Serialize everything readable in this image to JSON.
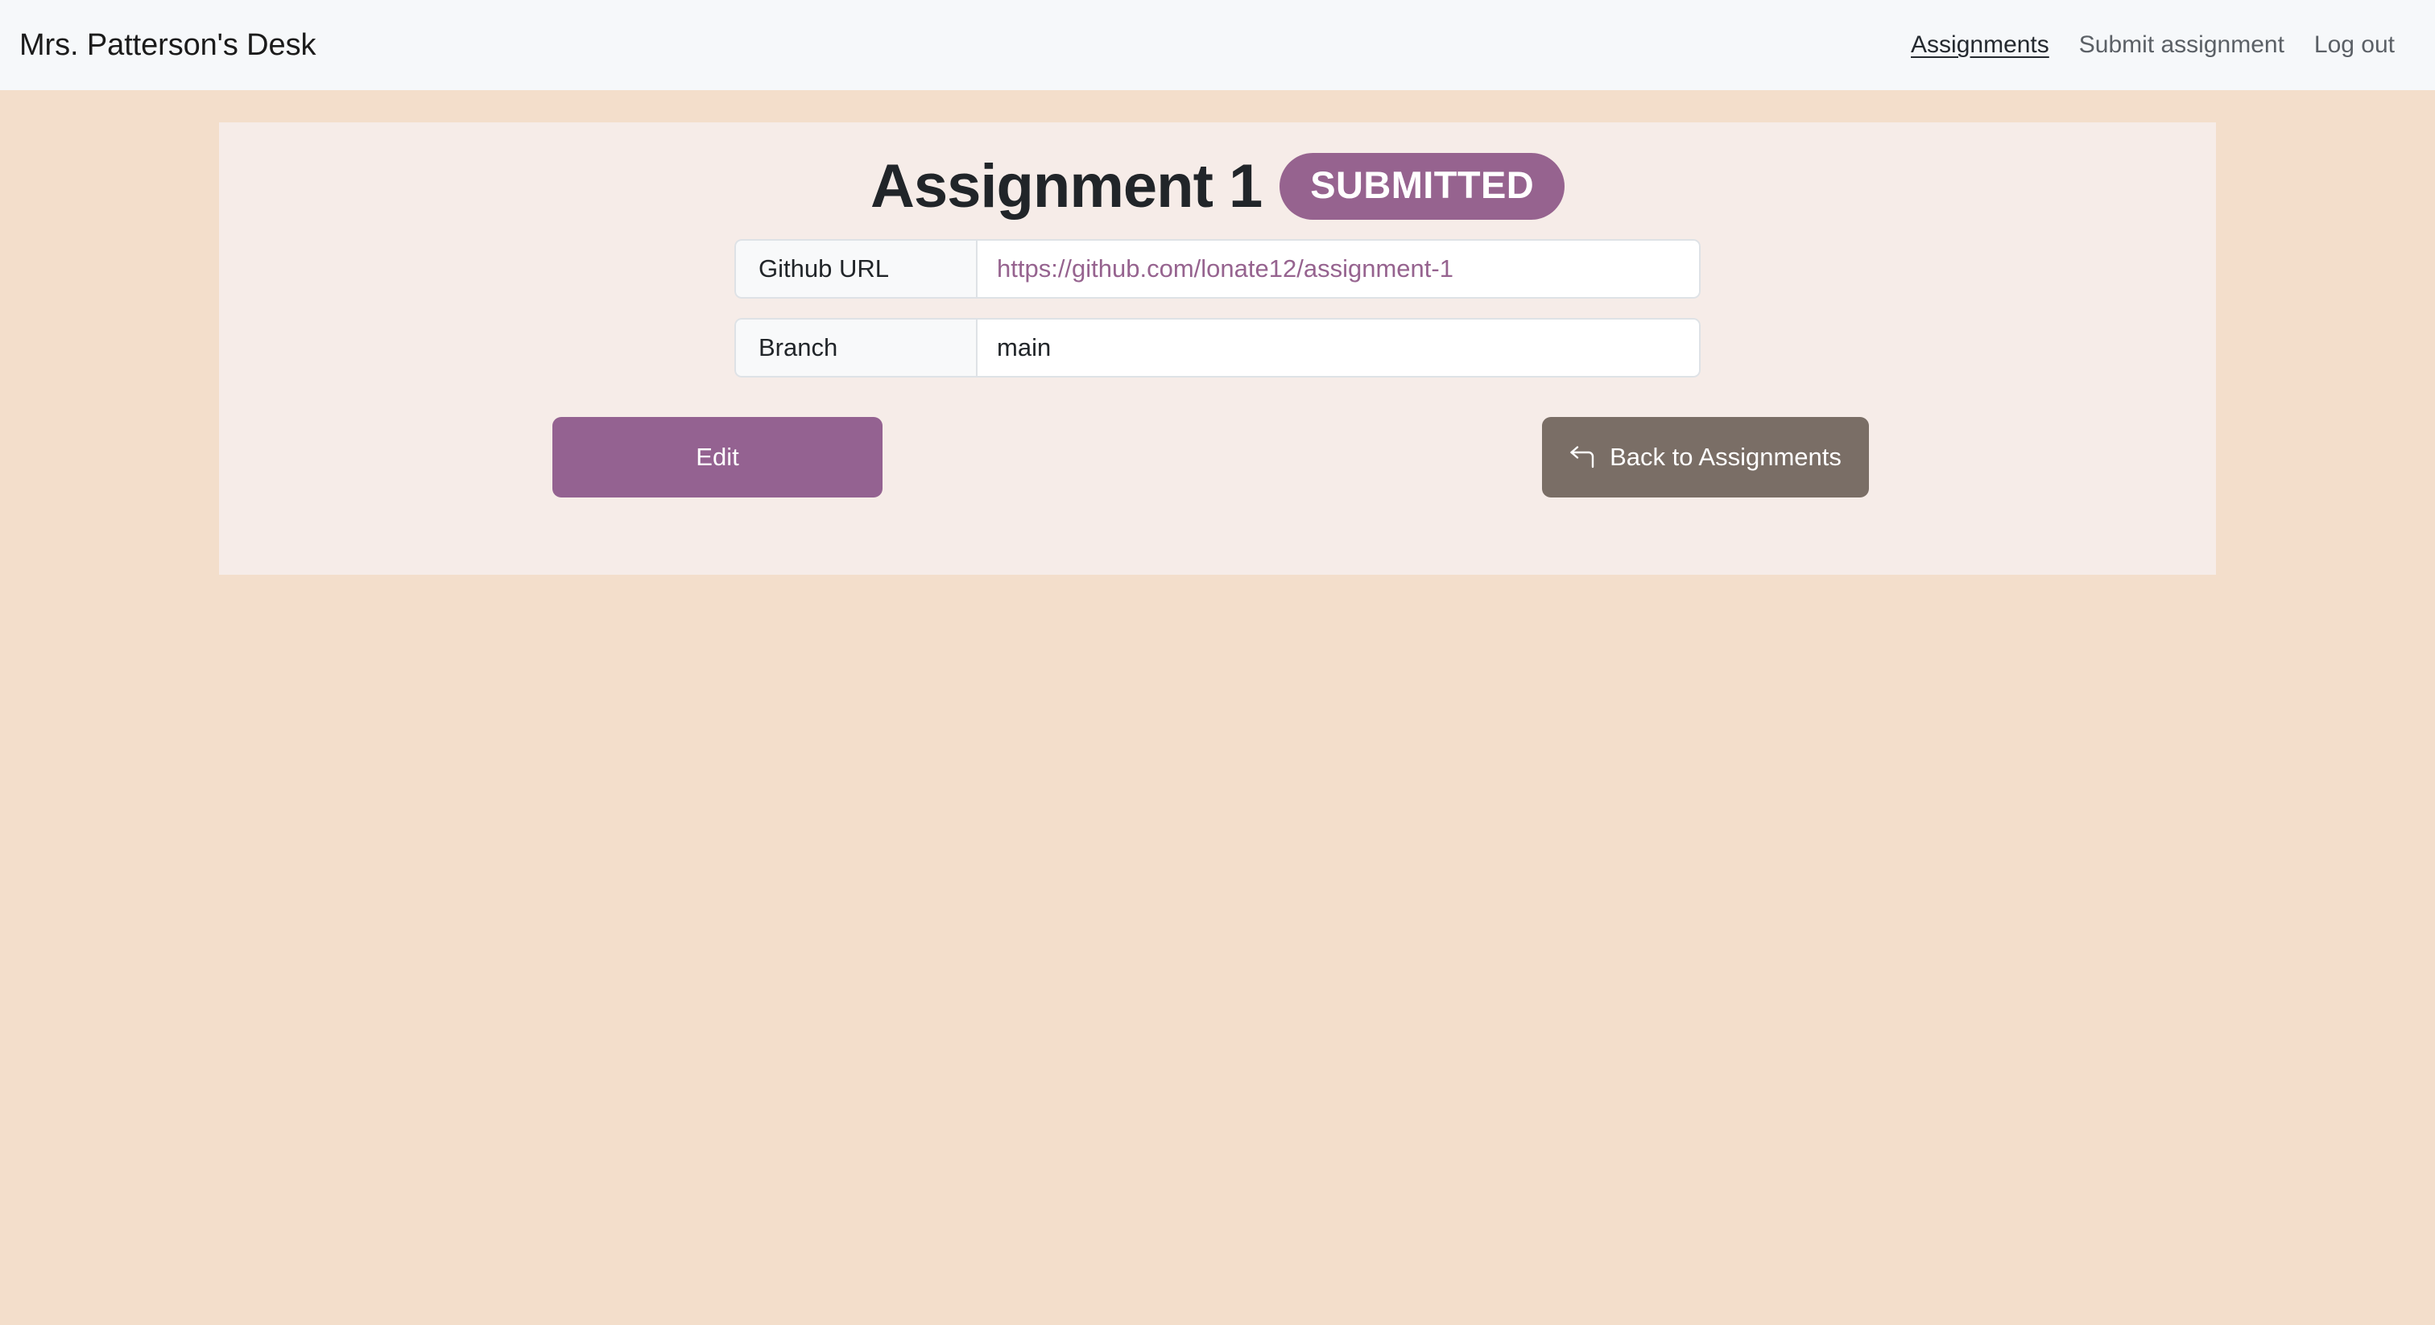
{
  "navbar": {
    "brand": "Mrs. Patterson's Desk",
    "links": [
      {
        "label": "Assignments",
        "active": true
      },
      {
        "label": "Submit assignment",
        "active": false
      },
      {
        "label": "Log out",
        "active": false
      }
    ]
  },
  "card": {
    "title": "Assignment 1",
    "status_badge": "SUBMITTED",
    "fields": [
      {
        "label": "Github URL",
        "value": "https://github.com/lonate12/assignment-1",
        "is_link": true
      },
      {
        "label": "Branch",
        "value": "main",
        "is_link": false
      }
    ],
    "buttons": {
      "edit": "Edit",
      "back": "Back to Assignments",
      "back_icon": "arrow-turn-up-left-icon"
    }
  },
  "colors": {
    "page_background": "#f3decb",
    "navbar_background": "#f6f8fa",
    "card_background": "#f6ece8",
    "accent_purple": "#96638f",
    "edit_button": "#946291",
    "back_button": "#7a6e66",
    "link_text": "#96638f"
  }
}
